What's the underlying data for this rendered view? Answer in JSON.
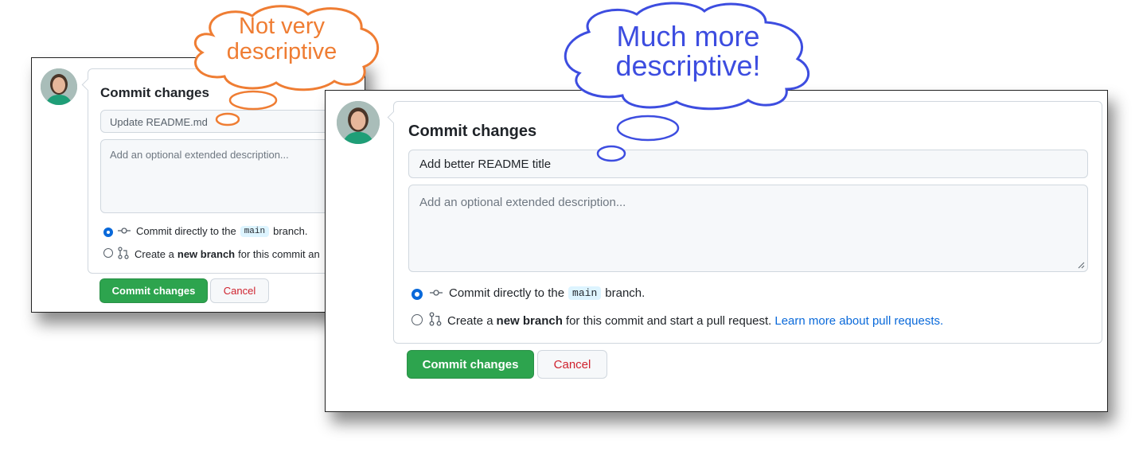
{
  "left_panel": {
    "title": "Commit changes",
    "summary_value": "Update README.md",
    "description_placeholder": "Add an optional extended description...",
    "option_direct": {
      "prefix": "Commit directly to the",
      "branch": "main",
      "suffix": "branch."
    },
    "option_new": {
      "prefix": "Create a",
      "bold": "new branch",
      "suffix": "for this commit an"
    },
    "commit_button": "Commit changes",
    "cancel_button": "Cancel"
  },
  "right_panel": {
    "title": "Commit changes",
    "summary_value": "Add better README title",
    "description_placeholder": "Add an optional extended description...",
    "option_direct": {
      "prefix": "Commit directly to the",
      "branch": "main",
      "suffix": "branch."
    },
    "option_new": {
      "prefix": "Create a",
      "bold": "new branch",
      "suffix": "for this commit and start a pull request.",
      "link": "Learn more about pull requests."
    },
    "commit_button": "Commit changes",
    "cancel_button": "Cancel"
  },
  "callouts": {
    "left": {
      "line1": "Not very",
      "line2": "descriptive",
      "color": "#ef7d33"
    },
    "right": {
      "line1": "Much more",
      "line2": "descriptive!",
      "color": "#3d4de0"
    }
  },
  "colors": {
    "accent_green": "#2da44e",
    "link_blue": "#0969da",
    "cancel_red": "#cf222e"
  },
  "icons": [
    "avatar",
    "git-commit-icon",
    "git-pull-request-icon",
    "resize-grip-icon",
    "thought-bubble"
  ]
}
